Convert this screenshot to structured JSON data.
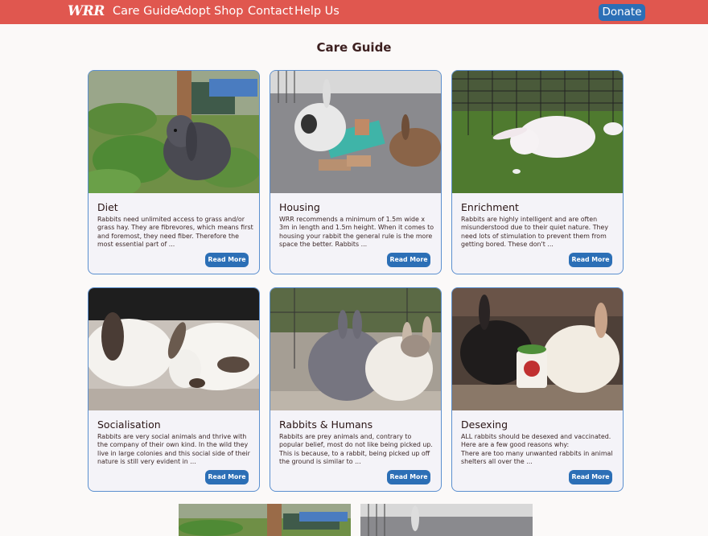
{
  "nav": {
    "logo": "WRR",
    "links": [
      "Care Guide",
      "Adopt",
      "Shop",
      "Contact",
      "Help Us"
    ],
    "donate": "Donate"
  },
  "page": {
    "title": "Care Guide"
  },
  "cards": [
    {
      "title": "Diet",
      "text": "Rabbits need unlimited access to grass and/or grass hay. They are fibrevores, which means first and foremost, they need fiber. Therefore the most essential part of ...",
      "button": "Read More"
    },
    {
      "title": "Housing",
      "text": "WRR recommends a minimum of 1.5m wide x 3m in length and 1.5m height. When it comes to housing your rabbit the general rule is the more space the better. Rabbits ...",
      "button": "Read More"
    },
    {
      "title": "Enrichment",
      "text": "Rabbits are highly intelligent and are often misunderstood due to their quiet nature. They need lots of stimulation to prevent them from getting bored. These don't ...",
      "button": "Read More"
    },
    {
      "title": "Socialisation",
      "text": "Rabbits are very social animals and thrive with the company of their own kind. In the wild they live in large colonies and this social side of their nature is still very evident in ...",
      "button": "Read More"
    },
    {
      "title": "Rabbits & Humans",
      "text": "Rabbits are prey animals and, contrary to popular belief, most do not like being picked up. This is because, to a rabbit, being picked up off the ground is similar to ...",
      "button": "Read More"
    },
    {
      "title": "Desexing",
      "text": "ALL rabbits should be desexed and vaccinated. Here are a few good reasons why:\nThere are too many unwanted rabbits in animal shelters all over the ...",
      "button": "Read More"
    }
  ]
}
